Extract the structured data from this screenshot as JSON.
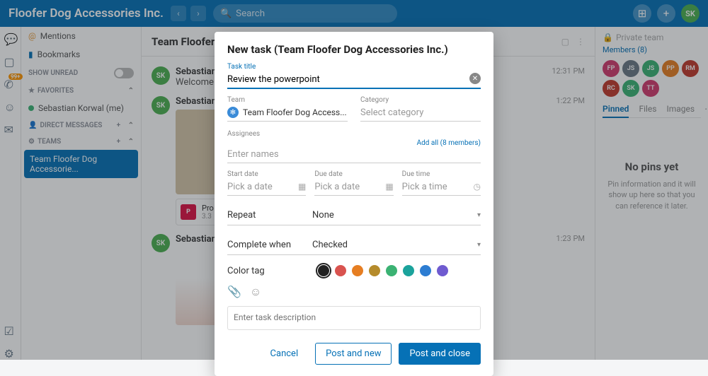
{
  "topbar": {
    "title": "Floofer Dog Accessories Inc.",
    "search_placeholder": "Search",
    "avatar": "SK"
  },
  "sidebar": {
    "mentions": "Mentions",
    "bookmarks": "Bookmarks",
    "show_unread": "SHOW UNREAD",
    "favorites": "FAVORITES",
    "fav_item": "Sebastian Korwal (me)",
    "dm": "DIRECT MESSAGES",
    "teams": "TEAMS",
    "team_item": "Team Floofer Dog Accessorie..."
  },
  "conversation": {
    "title": "Team Floofer Dog Accessories Inc.",
    "people": "8",
    "msgs": [
      {
        "av": "SK",
        "name": "Sebastian Ko",
        "text": "Welcome tea",
        "time": "12:31 PM"
      },
      {
        "av": "SK",
        "name": "Sebastian Ko",
        "text": "",
        "time": "1:22 PM",
        "file_label": "Pro",
        "file_size": "3.3"
      },
      {
        "av": "SK",
        "name": "Sebastian Ko",
        "text": "",
        "time": "1:23 PM"
      }
    ]
  },
  "rpanel": {
    "private": "Private team",
    "members_link": "Members (8)",
    "members": [
      {
        "t": "FP",
        "c": "#d23b6d"
      },
      {
        "t": "JS",
        "c": "#6a7884"
      },
      {
        "t": "JS",
        "c": "#3bb273"
      },
      {
        "t": "PP",
        "c": "#e67e22"
      },
      {
        "t": "RM",
        "c": "#c0392b"
      },
      {
        "t": "RC",
        "c": "#c0392b"
      },
      {
        "t": "SK",
        "c": "#3bb273"
      },
      {
        "t": "TT",
        "c": "#d23b6d"
      }
    ],
    "tabs": [
      "Pinned",
      "Files",
      "Images"
    ],
    "nopin_title": "No pins yet",
    "nopin_text": "Pin information and it will show up here so that you can reference it later."
  },
  "modal": {
    "title": "New task (Team Floofer Dog Accessories Inc.)",
    "task_title_label": "Task title",
    "task_title_value": "Review the powerpoint",
    "team_label": "Team",
    "team_value": "Team Floofer Dog Access...",
    "category_label": "Category",
    "category_placeholder": "Select category",
    "assignees_label": "Assignees",
    "assignees_placeholder": "Enter names",
    "add_all": "Add all (8 members)",
    "start_date_label": "Start date",
    "due_date_label": "Due date",
    "due_time_label": "Due time",
    "date_placeholder": "Pick a date",
    "time_placeholder": "Pick a time",
    "repeat_label": "Repeat",
    "repeat_value": "None",
    "complete_label": "Complete when",
    "complete_value": "Checked",
    "color_label": "Color tag",
    "colors": [
      "#222",
      "#d9534f",
      "#e67e22",
      "#b58b2b",
      "#3bb273",
      "#1ba39c",
      "#2d7dd2",
      "#6f5bd0"
    ],
    "color_selected": 0,
    "desc_placeholder": "Enter task description",
    "cancel": "Cancel",
    "post_new": "Post and new",
    "post_close": "Post and close"
  }
}
